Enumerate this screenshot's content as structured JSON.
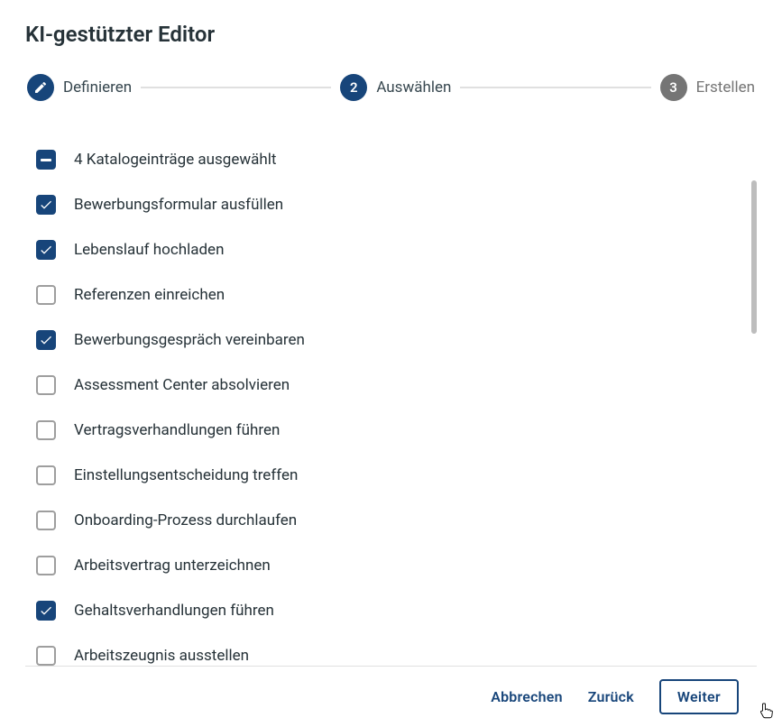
{
  "title": "KI-gestützter Editor",
  "stepper": {
    "step1": {
      "label": "Definieren"
    },
    "step2": {
      "number": "2",
      "label": "Auswählen"
    },
    "step3": {
      "number": "3",
      "label": "Erstellen"
    }
  },
  "selection_summary": "4 Katalogeinträge ausgewählt",
  "items": [
    {
      "label": "Bewerbungsformular ausfüllen",
      "checked": true
    },
    {
      "label": "Lebenslauf hochladen",
      "checked": true
    },
    {
      "label": "Referenzen einreichen",
      "checked": false
    },
    {
      "label": "Bewerbungsgespräch vereinbaren",
      "checked": true
    },
    {
      "label": "Assessment Center absolvieren",
      "checked": false
    },
    {
      "label": "Vertragsverhandlungen führen",
      "checked": false
    },
    {
      "label": "Einstellungsentscheidung treffen",
      "checked": false
    },
    {
      "label": "Onboarding-Prozess durchlaufen",
      "checked": false
    },
    {
      "label": "Arbeitsvertrag unterzeichnen",
      "checked": false
    },
    {
      "label": "Gehaltsverhandlungen führen",
      "checked": true
    },
    {
      "label": "Arbeitszeugnis ausstellen",
      "checked": false
    }
  ],
  "footer": {
    "cancel": "Abbrechen",
    "back": "Zurück",
    "next": "Weiter"
  },
  "colors": {
    "primary": "#17457a",
    "muted": "#757575"
  }
}
